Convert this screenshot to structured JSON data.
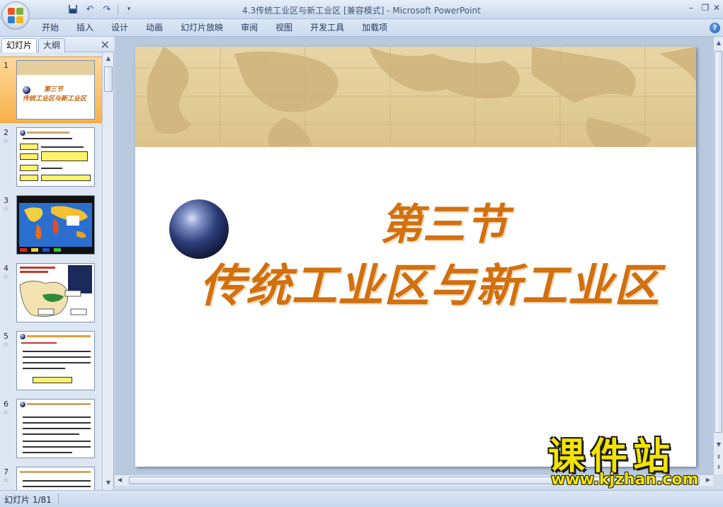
{
  "window": {
    "title": "4.3传统工业区与新工业区 [兼容模式] - Microsoft PowerPoint",
    "minimize": "–",
    "restore": "❐",
    "close": "✕"
  },
  "quick_access": {
    "save_icon": "save-icon",
    "undo_icon": "undo-icon",
    "redo_icon": "redo-icon"
  },
  "ribbon": {
    "tabs": [
      "开始",
      "插入",
      "设计",
      "动画",
      "幻灯片放映",
      "审阅",
      "视图",
      "开发工具",
      "加载项"
    ],
    "help": "?"
  },
  "left_panel": {
    "tab_slides": "幻灯片",
    "tab_outline": "大纲",
    "close": "✕",
    "slides": [
      {
        "num": "1",
        "title_line1": "第三节",
        "title_line2": "传统工业区与新工业区"
      },
      {
        "num": "2"
      },
      {
        "num": "3"
      },
      {
        "num": "4"
      },
      {
        "num": "5"
      },
      {
        "num": "6"
      },
      {
        "num": "7"
      }
    ],
    "star": "☆"
  },
  "slide": {
    "title": "第三节",
    "subtitle": "传统工业区与新工业区"
  },
  "status": {
    "slide_info": "幻灯片 1/81"
  },
  "watermark": {
    "name": "课件站",
    "url": "www.kjzhan.com"
  },
  "colors": {
    "accent_orange": "#d2700f",
    "map_tan": "#e3cd98",
    "selected_slide": "#f7b14a"
  }
}
